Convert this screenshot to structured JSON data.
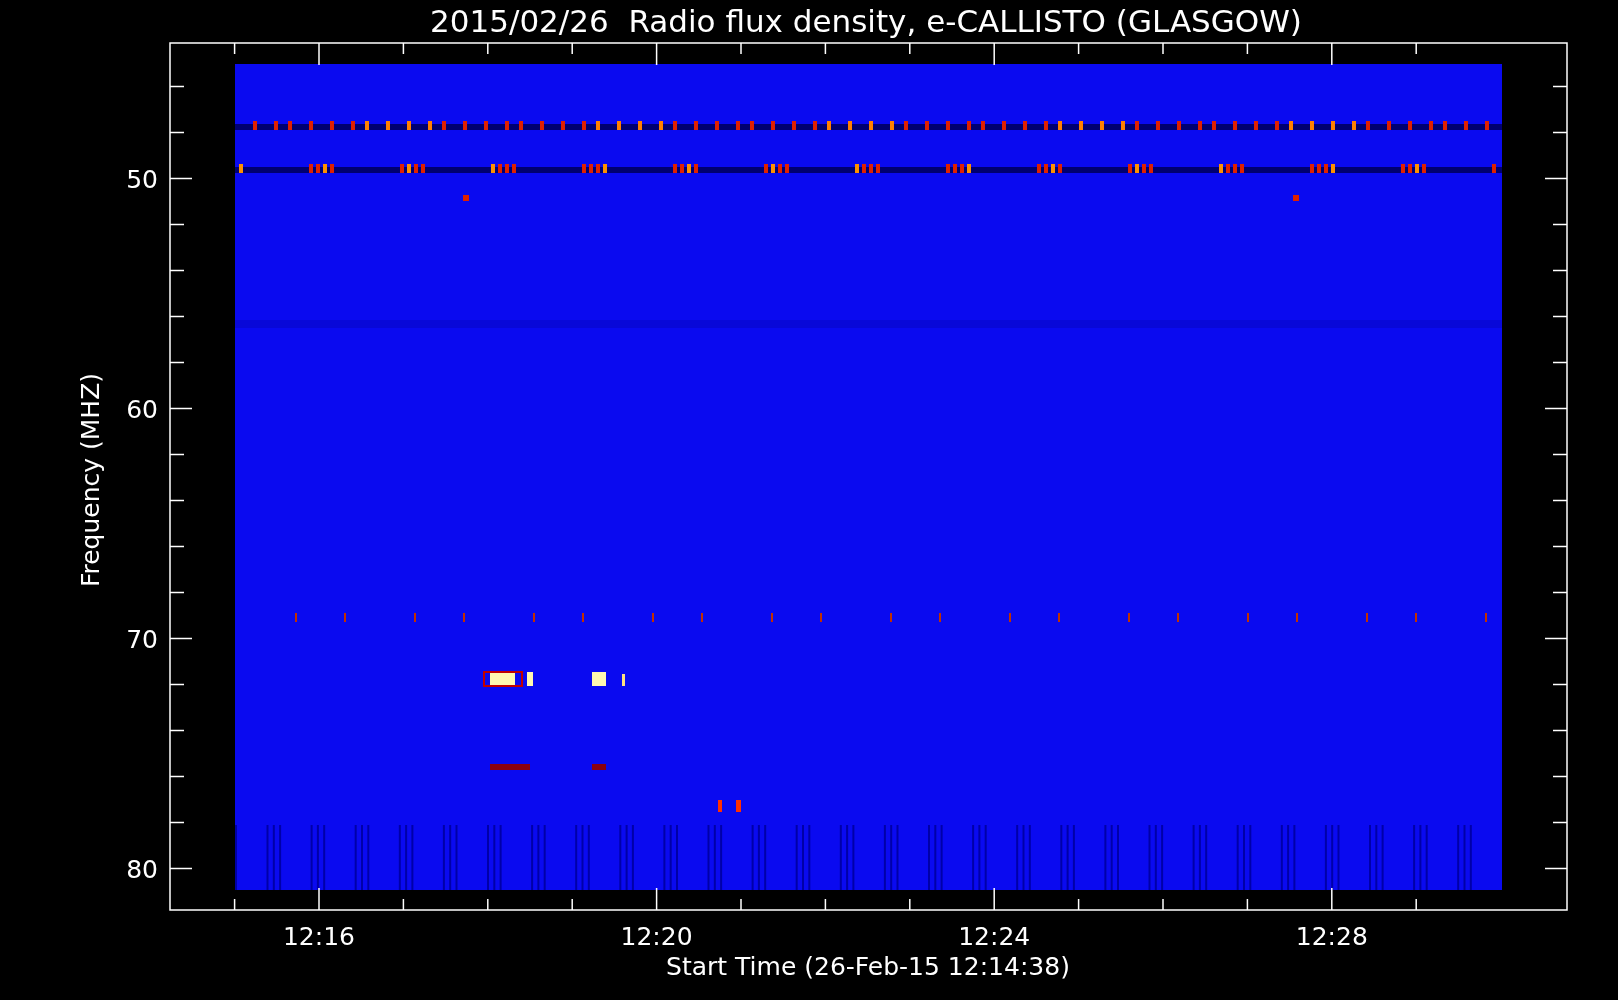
{
  "title": "2015/02/26  Radio flux density, e-CALLISTO (GLASGOW)",
  "y_axis": {
    "label": "Frequency (MHZ)",
    "ticks": [
      "50",
      "60",
      "70",
      "80"
    ]
  },
  "x_axis": {
    "label": "Start Time (26-Feb-15 12:14:38)",
    "ticks": [
      "12:16",
      "12:20",
      "12:24",
      "12:28"
    ]
  }
}
